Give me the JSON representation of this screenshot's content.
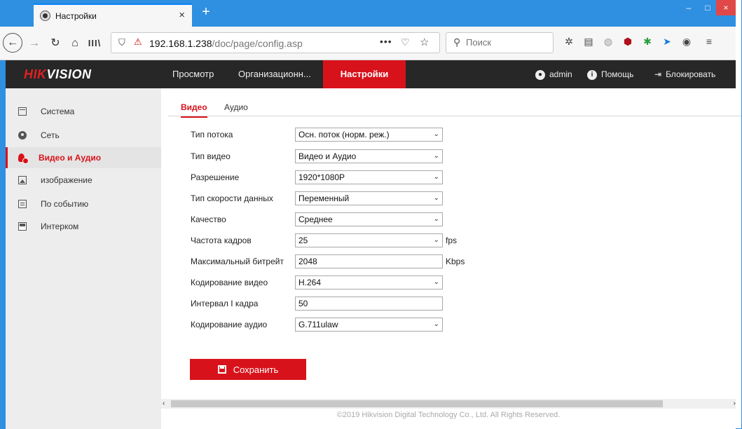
{
  "browser": {
    "tab_title": "Настройки",
    "tab_close": "×",
    "new_tab": "+",
    "window_controls": {
      "minimize": "‒",
      "maximize": "□",
      "close": "×"
    },
    "url_host": "192.168.1.238",
    "url_path": "/doc/page/config.asp",
    "url_more": "•••",
    "search_placeholder": "Поиск",
    "icons": [
      "back-icon",
      "forward-icon",
      "reload-icon",
      "home-icon",
      "library-icon",
      "shield-icon",
      "insecure-lock-icon",
      "pocket-icon",
      "star-icon",
      "extension-icons"
    ]
  },
  "header": {
    "logo_red": "HIK",
    "logo_white": "VISION",
    "nav": [
      "Просмотр",
      "Организационн...",
      "Настройки"
    ],
    "active_nav": "Настройки",
    "user": "admin",
    "help": "Помощь",
    "lock": "Блокировать"
  },
  "sidebar": {
    "items": [
      {
        "label": "Система",
        "icon": "system-icon"
      },
      {
        "label": "Сеть",
        "icon": "network-icon"
      },
      {
        "label": "Видео и Аудио",
        "icon": "video-audio-icon"
      },
      {
        "label": "изображение",
        "icon": "image-icon"
      },
      {
        "label": "По событию",
        "icon": "event-icon"
      },
      {
        "label": "Интерком",
        "icon": "intercom-icon"
      }
    ],
    "active_index": 2
  },
  "content": {
    "tabs": [
      "Видео",
      "Аудио"
    ],
    "active_tab": "Видео",
    "fields": {
      "stream_type": {
        "label": "Тип потока",
        "value": "Осн. поток (норм. реж.)"
      },
      "video_type": {
        "label": "Тип видео",
        "value": "Видео и Аудио"
      },
      "resolution": {
        "label": "Разрешение",
        "value": "1920*1080P"
      },
      "bitrate_type": {
        "label": "Тип скорости данных",
        "value": "Переменный"
      },
      "quality": {
        "label": "Качество",
        "value": "Среднее"
      },
      "frame_rate": {
        "label": "Частота кадров",
        "value": "25",
        "unit": "fps"
      },
      "max_bitrate": {
        "label": "Максимальный битрейт",
        "value": "2048",
        "unit": "Kbps"
      },
      "video_encoding": {
        "label": "Кодирование видео",
        "value": "H.264"
      },
      "i_frame_interval": {
        "label": "Интервал I кадра",
        "value": "50"
      },
      "audio_encoding": {
        "label": "Кодирование аудио",
        "value": "G.711ulaw"
      }
    },
    "save_label": "Сохранить",
    "footer": "©2019 Hikvision Digital Technology Co., Ltd. All Rights Reserved."
  },
  "colors": {
    "accent": "#d8121b",
    "header_bg": "#272727",
    "sidebar_bg": "#ededed",
    "titlebar": "#2f8fe0"
  }
}
